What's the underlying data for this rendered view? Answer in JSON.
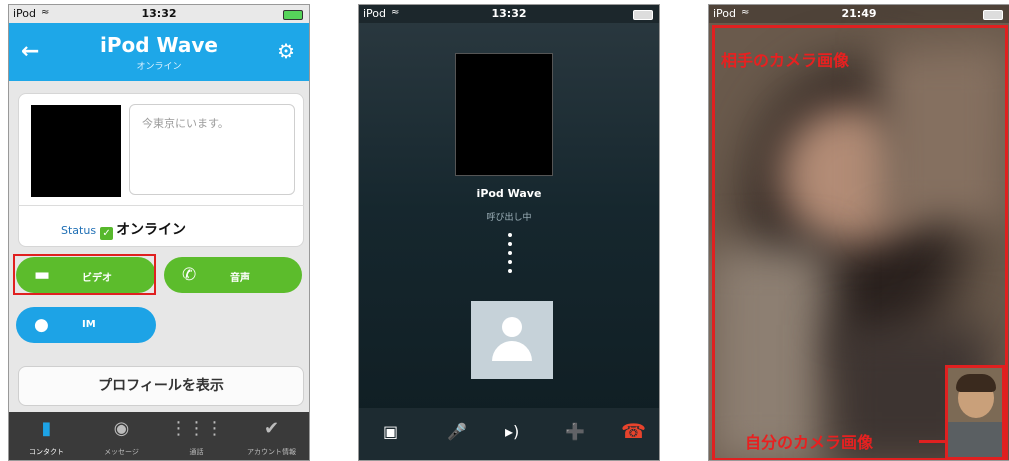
{
  "colors": {
    "skype_blue": "#1ea7e8",
    "call_green": "#5cbc2c",
    "highlight_red": "#e02020",
    "end_red": "#e8432c"
  },
  "screen1": {
    "carrier": "iPod",
    "time": "13:32",
    "contact_name": "iPod Wave",
    "contact_presence": "オンライン",
    "back_icon": "arrow-left-icon",
    "settings_icon": "gear-icon",
    "mood_message": "今東京にいます。",
    "status_label": "Status",
    "status_value": "オンライン",
    "video_label": "ビデオ",
    "voice_label": "音声",
    "im_label": "IM",
    "view_profile": "プロフィールを表示",
    "tabs": [
      {
        "label": "コンタクト",
        "icon": "contacts-icon"
      },
      {
        "label": "メッセージ",
        "icon": "chat-bubble-icon"
      },
      {
        "label": "通話",
        "icon": "dialpad-icon"
      },
      {
        "label": "アカウント情報",
        "icon": "checkmark-icon"
      }
    ]
  },
  "screen2": {
    "carrier": "iPod",
    "time": "13:32",
    "caller_name": "iPod Wave",
    "call_status": "呼び出し中",
    "controls": [
      "video-camera-icon",
      "microphone-icon",
      "speaker-icon",
      "add-call-icon",
      "end-call-icon"
    ]
  },
  "screen3": {
    "carrier": "iPod",
    "time": "21:49",
    "remote_label": "相手のカメラ画像",
    "self_label": "自分のカメラ画像"
  }
}
